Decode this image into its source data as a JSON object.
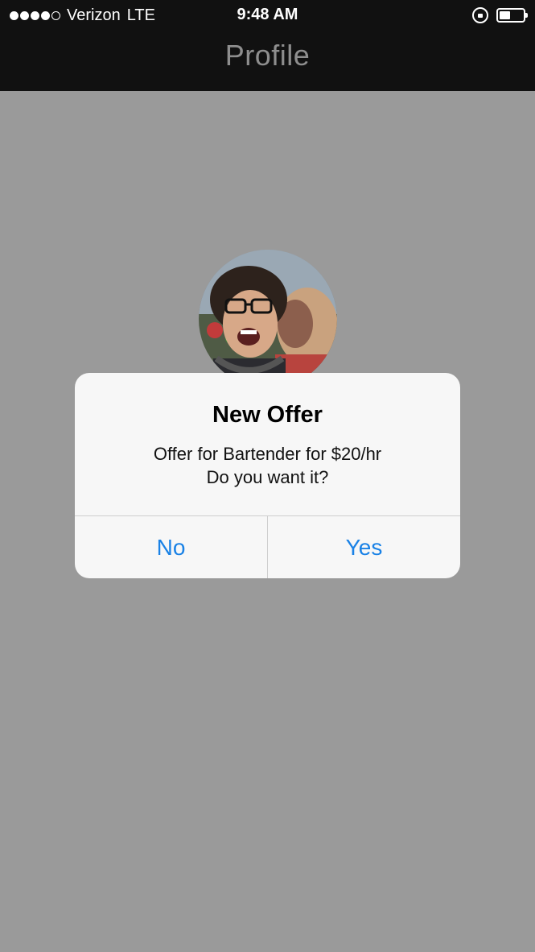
{
  "status_bar": {
    "carrier": "Verizon",
    "network": "LTE",
    "time": "9:48 AM",
    "signal_bars_filled": 4,
    "signal_bars_total": 5,
    "battery_level": 0.45,
    "icons": [
      "signal-dots-icon",
      "rotation-lock-icon",
      "battery-icon"
    ]
  },
  "nav": {
    "title": "Profile"
  },
  "profile": {
    "avatar": "profile-photo"
  },
  "alert": {
    "title": "New Offer",
    "message_line1": "Offer for Bartender for $20/hr",
    "message_line2": "Do you want it?",
    "buttons": {
      "no": "No",
      "yes": "Yes"
    },
    "accent_color": "#1a82e6"
  },
  "colors": {
    "nav_background": "#111111",
    "overlay_background": "#9a9a9a",
    "alert_background": "#f7f7f7"
  }
}
